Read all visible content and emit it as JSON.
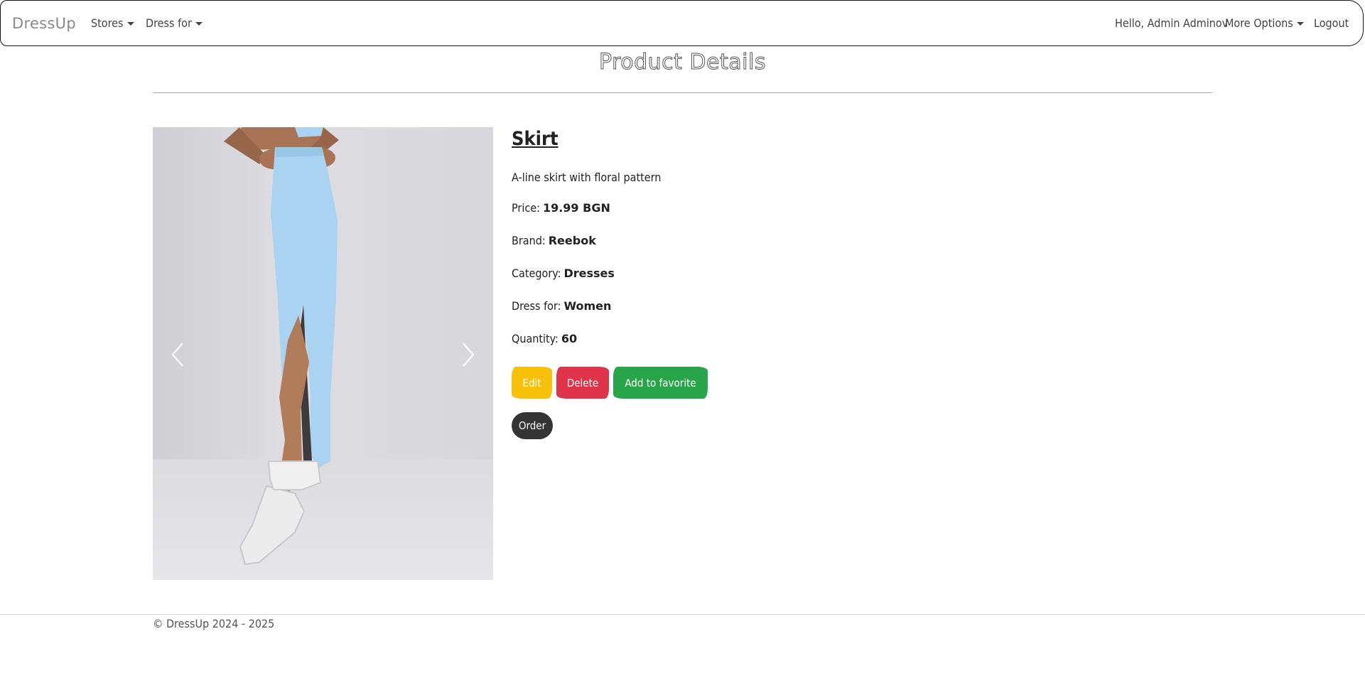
{
  "navbar": {
    "brand": "DressUp",
    "stores_label": "Stores",
    "dress_for_label": "Dress for",
    "greeting": "Hello, Admin Adminov",
    "more_options_label": "More Options",
    "logout_label": "Logout"
  },
  "page": {
    "title": "Product Details"
  },
  "carousel": {
    "image_subject": "model wearing light blue maxi skirt with side slit and white sneakers",
    "prev_icon": "chevron-left-icon",
    "next_icon": "chevron-right-icon"
  },
  "product": {
    "name": "Skirt",
    "description": "A-line skirt with floral pattern",
    "price_label": "Price:",
    "price": "19.99 BGN",
    "brand_label": "Brand:",
    "brand": "Reebok",
    "category_label": "Category:",
    "category": "Dresses",
    "dress_for_label": "Dress for:",
    "dress_for": "Women",
    "quantity_label": "Quantity:",
    "quantity": "60"
  },
  "actions": {
    "edit_label": "Edit",
    "delete_label": "Delete",
    "favorite_label": "Add to favorite",
    "order_label": "Order"
  },
  "footer": {
    "text": "© DressUp 2024 - 2025"
  },
  "colors": {
    "edit": "#f7c10a",
    "delete": "#e0344a",
    "favorite": "#27a548",
    "order": "#343434",
    "skirt": "#a9d3f0"
  }
}
